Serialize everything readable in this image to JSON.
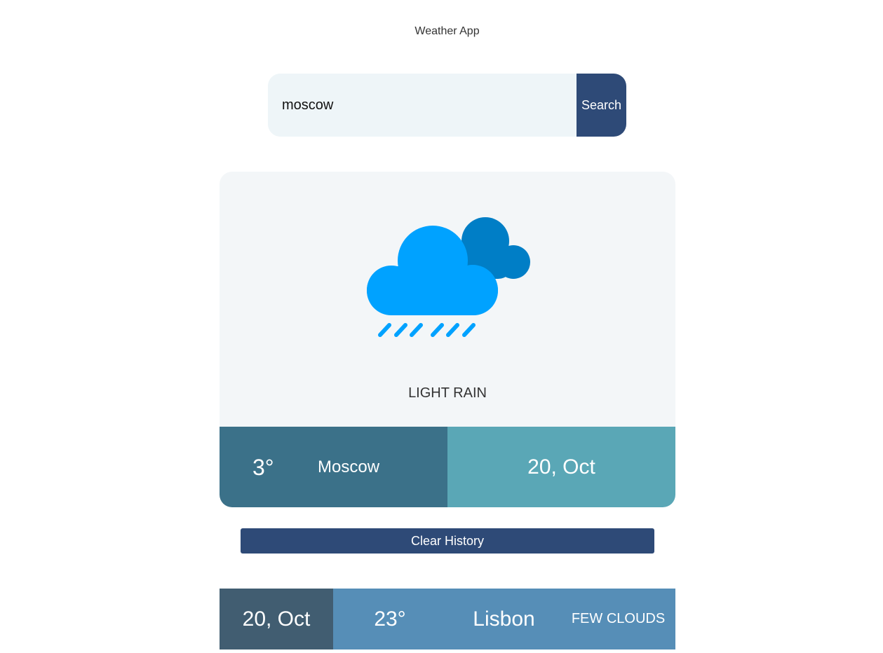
{
  "app": {
    "title": "Weather App"
  },
  "search": {
    "value": "moscow",
    "button_label": "Search"
  },
  "current": {
    "condition": "LIGHT RAIN",
    "temperature": "3°",
    "city": "Moscow",
    "date": "20, Oct",
    "icon": "cloud-rain-icon"
  },
  "history_controls": {
    "clear_label": "Clear History"
  },
  "history": [
    {
      "date": "20, Oct",
      "temperature": "23°",
      "city": "Lisbon",
      "condition": "FEW CLOUDS"
    }
  ],
  "colors": {
    "primary": "#2e4a77",
    "card_background": "#f3f6f8",
    "footer_left": "#3b7189",
    "footer_right": "#5aa7b6",
    "history_date": "#415d71",
    "history_row": "#568eb7",
    "cloud_front": "#00a2ff",
    "cloud_back": "#007ec6"
  }
}
